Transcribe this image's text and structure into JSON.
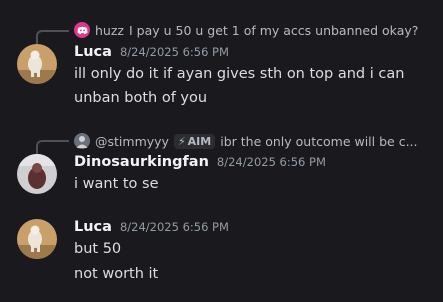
{
  "messages": [
    {
      "reply": {
        "name": "huzz",
        "text": "I pay u 50 u get 1 of my accs unbanned okay?",
        "avatar_icon": "discord-logo-icon",
        "avatar_color": "#e0358a"
      },
      "author": "Luca",
      "timestamp": "8/24/2025 6:56 PM",
      "lines": [
        "ill only do it if ayan gives sth on top and i can",
        "unban both of you"
      ]
    },
    {
      "reply": {
        "name": "@stimmyyy",
        "tag": "AIM",
        "tag_icon": "lightning-icon",
        "text": "ibr the only outcome will be c..."
      },
      "author": "Dinosaurkingfan",
      "timestamp": "8/24/2025 6:56 PM",
      "lines": [
        "i want to se"
      ]
    },
    {
      "author": "Luca",
      "timestamp": "8/24/2025 6:56 PM",
      "lines": [
        "but 50",
        "not worth it"
      ]
    }
  ]
}
